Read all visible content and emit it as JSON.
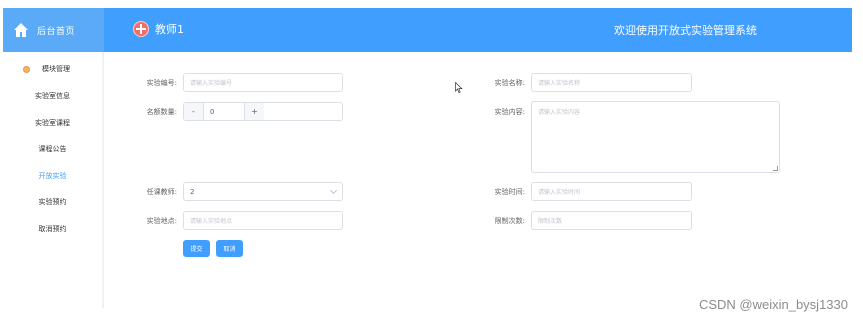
{
  "header": {
    "brand_label": "后台首页",
    "teacher_name": "教师1",
    "system_title": "欢迎使用开放式实验管理系统"
  },
  "sidebar": {
    "group_label": "模块管理",
    "items": [
      {
        "label": "实验室信息"
      },
      {
        "label": "实验室课程"
      },
      {
        "label": "课程公告"
      },
      {
        "label": "开放实验"
      },
      {
        "label": "实验预约"
      },
      {
        "label": "取消预约"
      }
    ],
    "active_index": 3
  },
  "form": {
    "exp_no": {
      "label": "实验编号:",
      "placeholder": "请输入实验编号"
    },
    "exp_name": {
      "label": "实验名称:",
      "placeholder": "请输入实验名称"
    },
    "quota": {
      "label": "名额数量:",
      "value": "0",
      "minus": "-",
      "plus": "+"
    },
    "exp_content": {
      "label": "实验内容:",
      "placeholder": "请输入实验内容"
    },
    "teacher": {
      "label": "任课教师:",
      "value": "2"
    },
    "exp_time": {
      "label": "实验时间:",
      "placeholder": "请输入实验时间"
    },
    "location": {
      "label": "实验地点:",
      "placeholder": "请输入实验地点"
    },
    "limit": {
      "label": "限制次数:",
      "placeholder": "限制次数"
    },
    "submit_label": "提交",
    "cancel_label": "取消"
  },
  "watermark": "CSDN @weixin_bysj1330",
  "colors": {
    "primary": "#409eff",
    "avatar": "#f56c6c",
    "bullet": "#f7b267"
  }
}
